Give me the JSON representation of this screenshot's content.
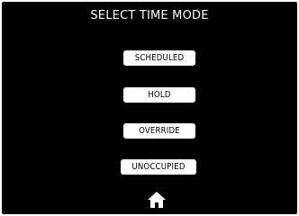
{
  "screen": {
    "title": "SELECT TIME MODE",
    "background_color": "#000000",
    "text_color": "#ffffff"
  },
  "modes": [
    {
      "label": "SCHEDULED"
    },
    {
      "label": "HOLD"
    },
    {
      "label": "OVERRIDE"
    },
    {
      "label": "UNOCCUPIED"
    }
  ],
  "footer": {
    "home_icon": "home-icon"
  }
}
